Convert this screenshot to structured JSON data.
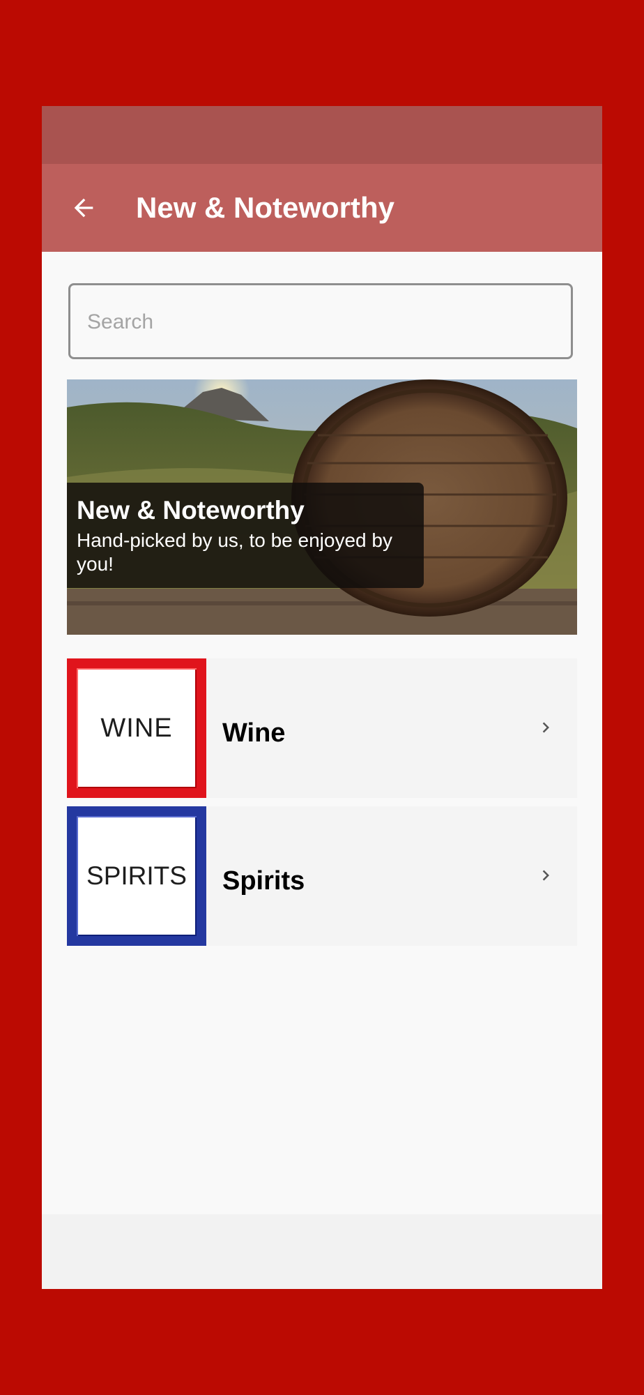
{
  "app_bar": {
    "title": "New & Noteworthy",
    "back_icon": "arrow-left-icon"
  },
  "search": {
    "placeholder": "Search",
    "value": ""
  },
  "banner": {
    "title": "New & Noteworthy",
    "subtitle": "Hand-picked by us, to be enjoyed by you!"
  },
  "categories": [
    {
      "label": "Wine",
      "thumbnail_text": "WINE",
      "thumbnail_border_color": "#e0141c",
      "icon": "chevron-right-icon"
    },
    {
      "label": "Spirits",
      "thumbnail_text": "SPIRITS",
      "thumbnail_border_color": "#2438a0",
      "icon": "chevron-right-icon"
    }
  ],
  "colors": {
    "outer_background": "#bb0a02",
    "status_bar": "#a95350",
    "app_bar": "#bd5f5c",
    "content_background": "#f9f9f9"
  }
}
